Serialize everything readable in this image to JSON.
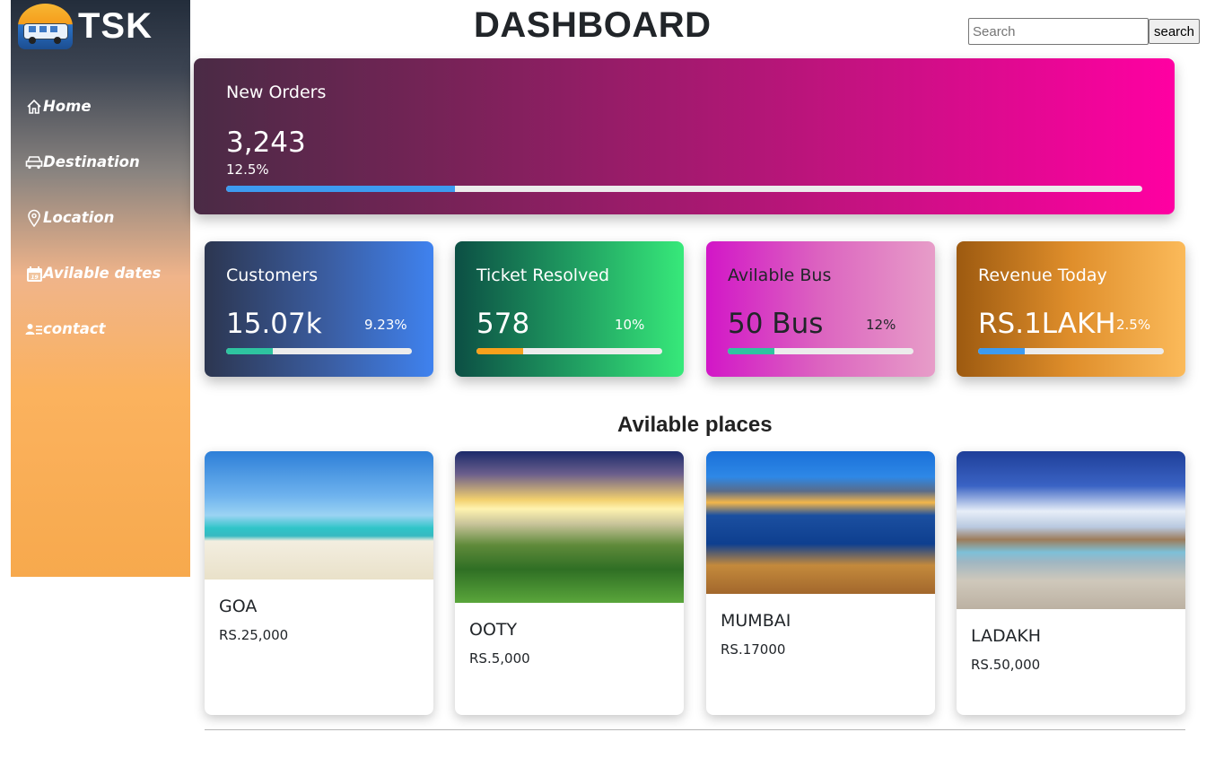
{
  "sidebar": {
    "brand": "TSK",
    "items": [
      {
        "label": "Home",
        "icon": "home-icon"
      },
      {
        "label": "Destination",
        "icon": "car-icon"
      },
      {
        "label": "Location",
        "icon": "location-pin-icon"
      },
      {
        "label": "Avilable dates",
        "icon": "calendar-icon"
      },
      {
        "label": "contact",
        "icon": "contact-card-icon"
      }
    ]
  },
  "header": {
    "title": "DASHBOARD",
    "search_placeholder": "Search",
    "search_button": "search"
  },
  "stats": {
    "new_orders": {
      "label": "New Orders",
      "value": "3,243",
      "percent": "12.5%",
      "progress": 0.25,
      "bar_color": "#3d9bf0"
    },
    "cards": [
      {
        "label": "Customers",
        "value": "15.07k",
        "percent": "9.23%",
        "progress": 0.25,
        "bar_color": "#2ec4a0"
      },
      {
        "label": "Ticket Resolved",
        "value": "578",
        "percent": "10%",
        "progress": 0.25,
        "bar_color": "#f7a11c"
      },
      {
        "label": "Avilable Bus",
        "value": "50 Bus",
        "percent": "12%",
        "progress": 0.25,
        "bar_color": "#2ec4a0"
      },
      {
        "label": "Revenue Today",
        "value": "RS.1LAKH",
        "percent": "2.5%",
        "progress": 0.25,
        "bar_color": "#3d9bf0"
      }
    ]
  },
  "places": {
    "title": "Avilable places",
    "items": [
      {
        "name": "GOA",
        "price": "RS.25,000"
      },
      {
        "name": "OOTY",
        "price": "RS.5,000"
      },
      {
        "name": "MUMBAI",
        "price": "RS.17000"
      },
      {
        "name": "LADAKH",
        "price": "RS.50,000"
      }
    ]
  }
}
